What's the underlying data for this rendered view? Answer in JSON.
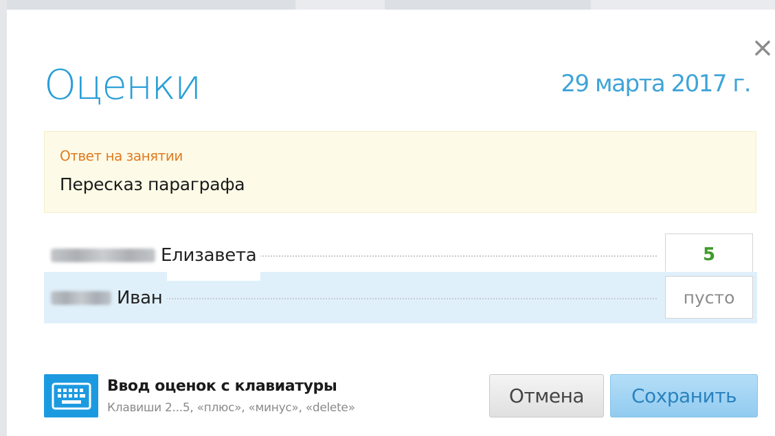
{
  "dialog": {
    "title": "Оценки",
    "date": "29 марта 2017 г.",
    "close_icon": "close-icon"
  },
  "task": {
    "type": "Ответ на занятии",
    "name": "Пересказ параграфа"
  },
  "students": [
    {
      "first_name": "Елизавета",
      "grade": "5",
      "grade_placeholder": "",
      "active": false
    },
    {
      "first_name": "Иван",
      "grade": "",
      "grade_placeholder": "пусто",
      "active": true
    }
  ],
  "keyboard": {
    "icon": "keyboard-icon",
    "title": "Ввод оценок с клавиатуры",
    "hint": "Клавиши 2...5, «плюс», «минус», «delete»"
  },
  "buttons": {
    "cancel_label": "Отмена",
    "save_label": "Сохранить"
  },
  "colors": {
    "accent": "#2a9fd8",
    "task_type": "#e07b22",
    "grade_good": "#3f9a2b",
    "active_row": "#dff0fb",
    "task_bg": "#fdfbe7"
  }
}
